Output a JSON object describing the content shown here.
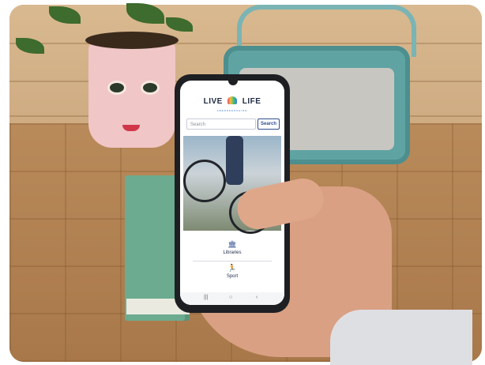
{
  "app": {
    "logo_left": "LIVE",
    "logo_right": "LIFE",
    "logo_subtitle": "ABERDEENSHIRE",
    "search": {
      "placeholder": "Search",
      "button_label": "Search"
    },
    "menu": [
      {
        "label": "Libraries",
        "icon": "library-icon"
      },
      {
        "label": "Sport",
        "icon": "runner-icon"
      }
    ],
    "navbar": [
      "menu-lines-icon",
      "home-circle-icon",
      "back-chevron-icon"
    ]
  },
  "colors": {
    "phone_body": "#1d1f23",
    "radio_teal": "#5fa3a3",
    "book_green": "#6cab8f",
    "brand_blue": "#2f4f8f"
  }
}
